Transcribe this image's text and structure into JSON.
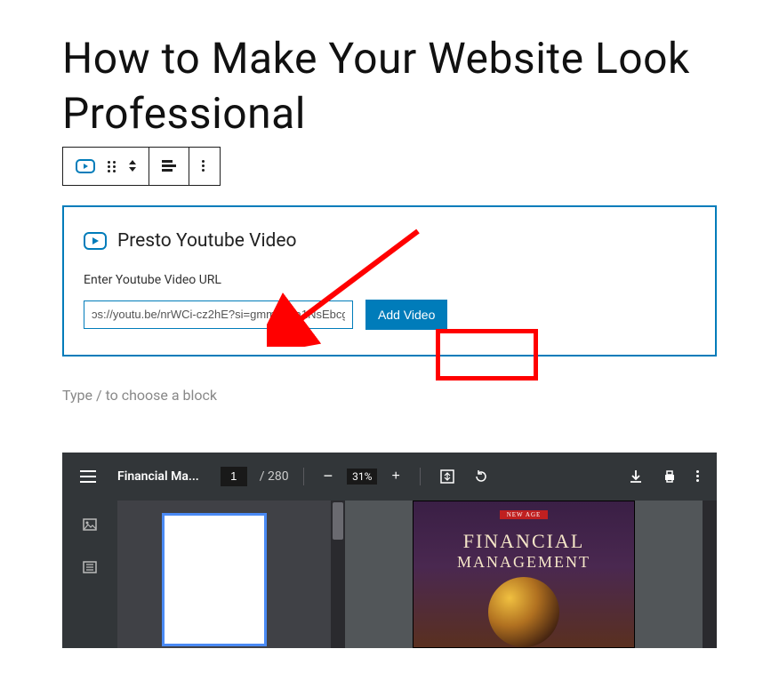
{
  "page_title": "How to Make Your Website Look Professional",
  "presto_block": {
    "title": "Presto Youtube Video",
    "label": "Enter Youtube Video URL",
    "input_value": "ɔs://youtu.be/nrWCi-cz2hE?si=gmmoI-xa1NsEbcg",
    "button_label": "Add Video"
  },
  "slash_hint": "Type / to choose a block",
  "pdf": {
    "title": "Financial Ma...",
    "page_current": "1",
    "page_total": "/ 280",
    "zoom_pct": "31%",
    "minus": "−",
    "plus": "+",
    "cover_badge": "NEW AGE",
    "cover_line1": "FINANCIAL",
    "cover_line2": "MANAGEMENT"
  }
}
